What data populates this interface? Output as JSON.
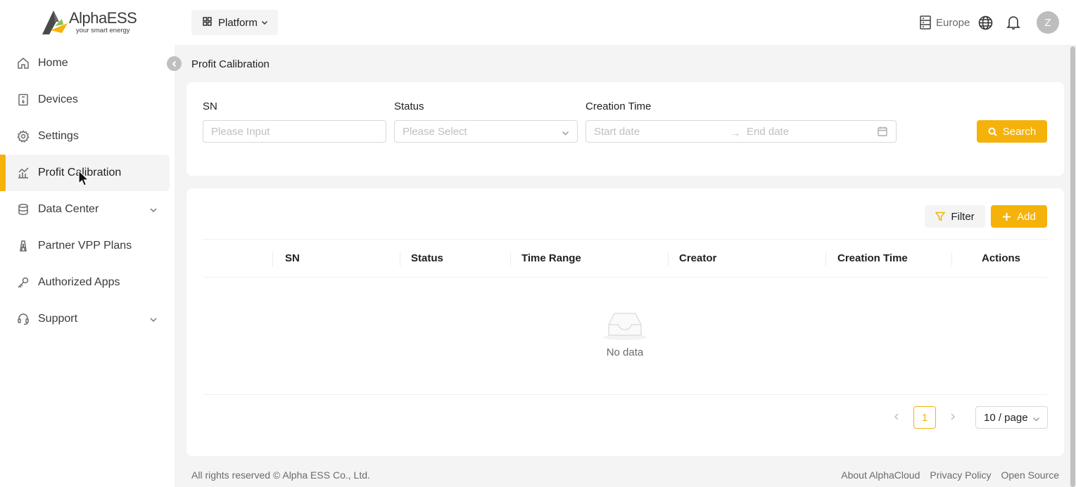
{
  "brand": {
    "name": "AlphaESS",
    "tagline": "your smart energy",
    "accent": "#f5b20b"
  },
  "sidebar": {
    "items": [
      {
        "label": "Home",
        "icon": "home-icon"
      },
      {
        "label": "Devices",
        "icon": "device-icon"
      },
      {
        "label": "Settings",
        "icon": "gear-icon"
      },
      {
        "label": "Profit Calibration",
        "icon": "chart-icon",
        "active": true
      },
      {
        "label": "Data Center",
        "icon": "database-icon",
        "expandable": true
      },
      {
        "label": "Partner VPP Plans",
        "icon": "map-icon"
      },
      {
        "label": "Authorized Apps",
        "icon": "key-icon"
      },
      {
        "label": "Support",
        "icon": "support-icon",
        "expandable": true
      }
    ]
  },
  "topbar": {
    "platform_label": "Platform",
    "region": "Europe",
    "avatar_initial": "Z"
  },
  "page": {
    "title": "Profit Calibration"
  },
  "filters": {
    "sn_label": "SN",
    "sn_placeholder": "Please Input",
    "status_label": "Status",
    "status_placeholder": "Please Select",
    "creation_label": "Creation Time",
    "start_placeholder": "Start date",
    "end_placeholder": "End date",
    "search_label": "Search"
  },
  "table": {
    "filter_label": "Filter",
    "add_label": "Add",
    "columns": [
      "SN",
      "Status",
      "Time Range",
      "Creator",
      "Creation Time",
      "Actions"
    ],
    "rows": [],
    "empty_text": "No data"
  },
  "pagination": {
    "current_page": "1",
    "page_size": "10 / page"
  },
  "footer": {
    "copyright": "All rights reserved © Alpha ESS Co., Ltd.",
    "links": [
      "About AlphaCloud",
      "Privacy Policy",
      "Open Source"
    ]
  }
}
